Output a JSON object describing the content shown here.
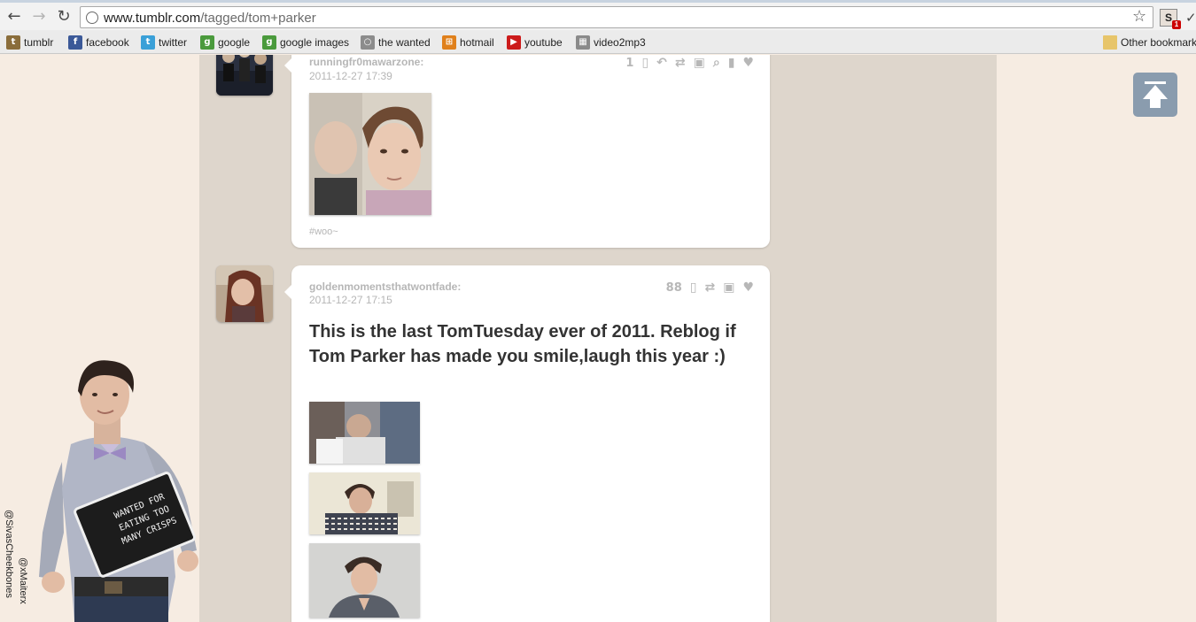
{
  "browser": {
    "url_host": "www.tumblr.com",
    "url_path": "/tagged/tom+parker",
    "back_glyph": "←",
    "forward_glyph": "→",
    "reload_glyph": "↻",
    "star_glyph": "☆",
    "ext_letter": "S",
    "ext_badge": "1"
  },
  "bookmarks": {
    "items": [
      {
        "label": "tumblr",
        "icon": "tumblr-icon",
        "color": "#8a6d3b",
        "glyph": "t"
      },
      {
        "label": "facebook",
        "icon": "facebook-icon",
        "color": "#3b5998",
        "glyph": "f"
      },
      {
        "label": "twitter",
        "icon": "twitter-icon",
        "color": "#3aa0d8",
        "glyph": "t"
      },
      {
        "label": "google",
        "icon": "google-icon",
        "color": "#4a9a3c",
        "glyph": "g"
      },
      {
        "label": "google images",
        "icon": "google-icon",
        "color": "#4a9a3c",
        "glyph": "g"
      },
      {
        "label": "the wanted",
        "icon": "globe-icon",
        "color": "#8c8c8c",
        "glyph": "○"
      },
      {
        "label": "hotmail",
        "icon": "windows-icon",
        "color": "#e0801b",
        "glyph": "⊞"
      },
      {
        "label": "youtube",
        "icon": "youtube-icon",
        "color": "#cc1b1b",
        "glyph": "▶"
      },
      {
        "label": "video2mp3",
        "icon": "video2mp3-icon",
        "color": "#8a8a8a",
        "glyph": "▦"
      }
    ],
    "other": "Other bookmarks"
  },
  "posts": [
    {
      "author": "runningfr0mawarzone:",
      "date": "2011-12-27 17:39",
      "notes": "1",
      "tags": "#woo~",
      "controls": [
        "notes-icon",
        "reply-icon",
        "reblog-icon",
        "photo-icon",
        "search-icon",
        "bookmark-icon",
        "heart-icon"
      ]
    },
    {
      "author": "goldenmomentsthatwontfade:",
      "date": "2011-12-27 17:15",
      "notes": "88",
      "text": "This is the last TomTuesday ever of 2011. Reblog if Tom Parker has made you smile,laugh this year :)",
      "controls": [
        "notes-icon",
        "reblog-icon",
        "photo-icon",
        "heart-icon"
      ]
    }
  ],
  "sidebar": {
    "sign_text": [
      "WANTED FOR",
      "EATING TOO",
      "MANY CRISPS"
    ],
    "credit_1": "@SivasCheekbones",
    "credit_2": "@xMaiterx"
  },
  "colors": {
    "page_bg": "#f6ece2",
    "column_bg": "#ded6cc",
    "post_bg": "#ffffff",
    "meta_text": "#b6b6b6",
    "to_top_button": "#8a9cae"
  }
}
